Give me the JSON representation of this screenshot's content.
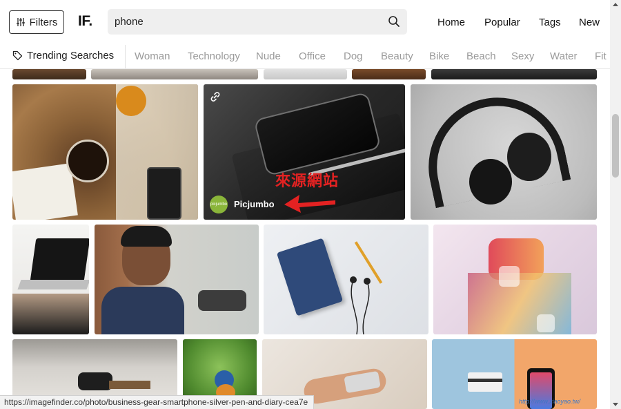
{
  "header": {
    "filters_label": "Filters",
    "logo": "IF.",
    "search_value": "phone",
    "nav": [
      "Home",
      "Popular",
      "Tags",
      "New"
    ]
  },
  "trending": {
    "label": "Trending Searches",
    "items": [
      "Woman",
      "Technology",
      "Nude",
      "Office",
      "Dog",
      "Beauty",
      "Bike",
      "Beach",
      "Sexy",
      "Water",
      "Fit"
    ]
  },
  "featured": {
    "source_name": "Picjumbo",
    "source_avatar_text": "picjumbo",
    "annotation_text": "來源網站",
    "link_icon": "link-icon"
  },
  "statusbar": {
    "url": "https://imagefinder.co/photo/business-gear-smartphone-silver-pen-and-diary-cea7e"
  },
  "watermark": {
    "text": "http://www.xiaoyao.tw/"
  },
  "colors": {
    "annotation": "#e32222",
    "avatar": "#8ab53a"
  }
}
